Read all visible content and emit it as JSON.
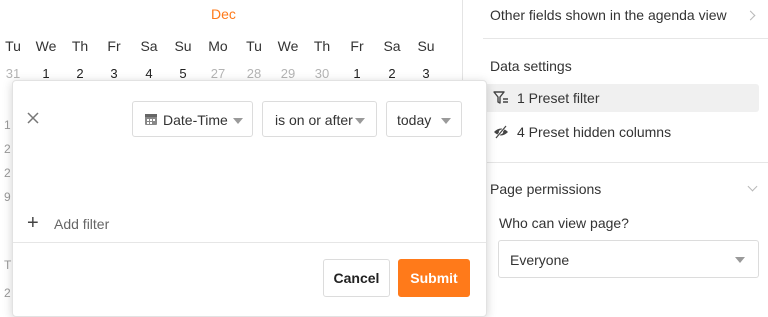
{
  "calendar": {
    "month": "Dec",
    "weekdays": [
      "Tu",
      "We",
      "Th",
      "Fr",
      "Sa",
      "Su",
      "Mo",
      "Tu",
      "We",
      "Th",
      "Fr",
      "Sa",
      "Su"
    ],
    "dates": [
      "31",
      "1",
      "2",
      "3",
      "4",
      "5",
      "27",
      "28",
      "29",
      "30",
      "1",
      "2",
      "3"
    ],
    "muted_dates": [
      0,
      6,
      7,
      8,
      9
    ],
    "edge_labels": [
      "1",
      "2",
      "2",
      "9",
      "T",
      "2"
    ],
    "accent": "#ff7a1a"
  },
  "filter_popover": {
    "column_select": {
      "value": "Date-Time",
      "icon": "calendar-icon"
    },
    "operator_select": {
      "value": "is on or after"
    },
    "value_select": {
      "value": "today"
    },
    "add_filter_label": "Add filter",
    "cancel_label": "Cancel",
    "submit_label": "Submit",
    "submit_color": "#ff7a1a"
  },
  "settings_panel": {
    "other_fields_label": "Other fields shown in the agenda view",
    "data_settings_title": "Data settings",
    "preset_filter_label": "1 Preset filter",
    "preset_hidden_label": "4 Preset hidden columns",
    "page_permissions_title": "Page permissions",
    "who_can_view_label": "Who can view page?",
    "who_can_view_value": "Everyone"
  }
}
